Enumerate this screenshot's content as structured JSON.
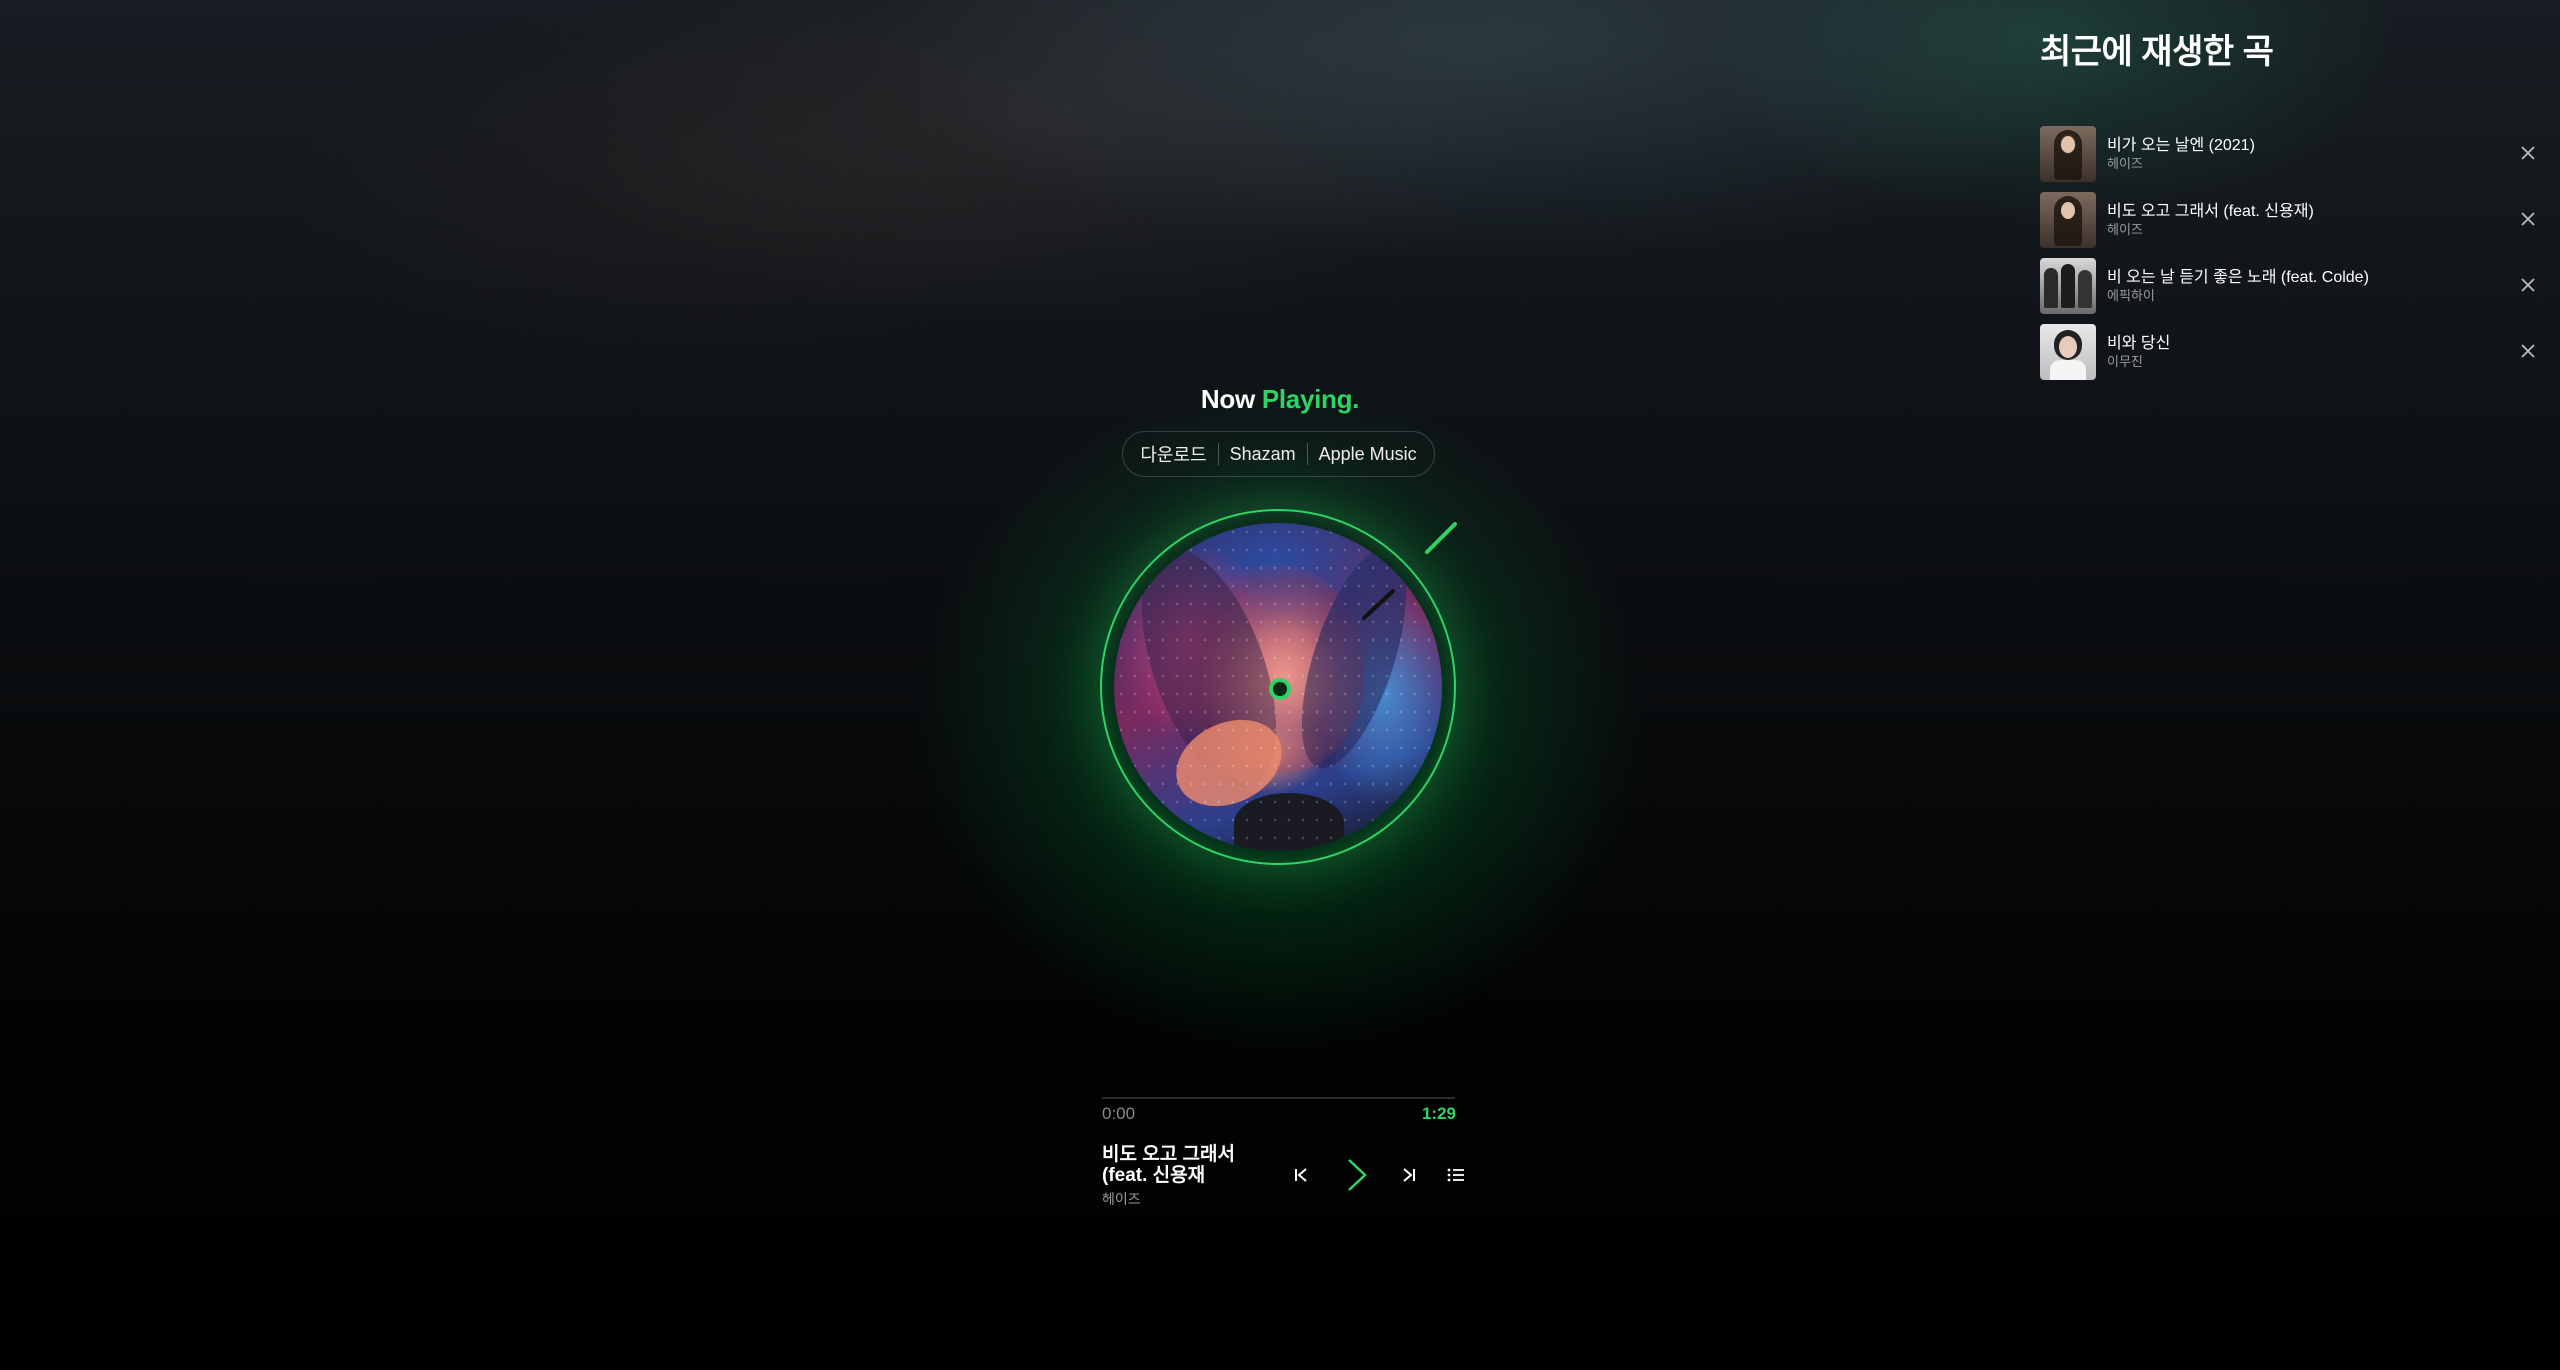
{
  "colors": {
    "accent": "#2dd565"
  },
  "recent": {
    "title": "최근에 재생한 곡",
    "items": [
      {
        "title": "비가 오는 날엔 (2021)",
        "artist": "헤이즈"
      },
      {
        "title": "비도 오고 그래서 (feat. 신용재)",
        "artist": "헤이즈"
      },
      {
        "title": "비 오는 날 듣기 좋은 노래 (feat. Colde)",
        "artist": "에픽하이"
      },
      {
        "title": "비와 당신",
        "artist": "이무진"
      }
    ]
  },
  "now_playing": {
    "title_word1": "Now",
    "title_word2": "Playing."
  },
  "links": [
    "다운로드",
    "Shazam",
    "Apple Music"
  ],
  "player": {
    "current_time": "0:00",
    "total_time": "1:29",
    "progress": 0,
    "song_title": "비도 오고 그래서 (feat. 신용재",
    "artist": "헤이즈"
  },
  "icons": {
    "prev": "skip-previous-icon",
    "play": "play-icon",
    "next": "skip-next-icon",
    "queue": "playlist-icon",
    "remove": "close-icon"
  }
}
